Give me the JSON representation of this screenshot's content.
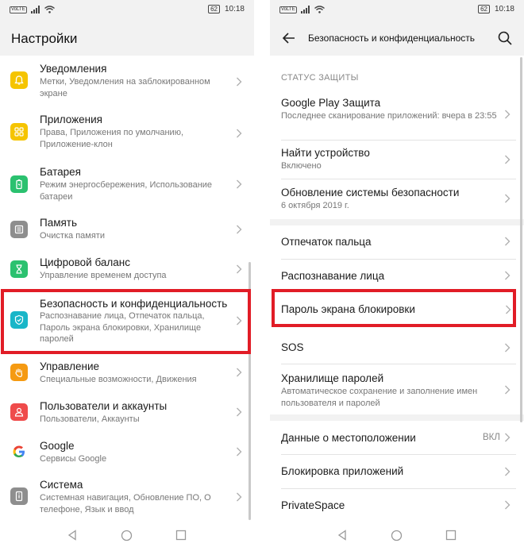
{
  "status_bar": {
    "sim": "VoLTE",
    "battery": "62",
    "time": "10:18"
  },
  "left": {
    "title": "Настройки",
    "items": [
      {
        "title": "Уведомления",
        "subtitle": "Метки, Уведомления на заблокированном экране",
        "icon": "bell-icon",
        "color": "#f5c400"
      },
      {
        "title": "Приложения",
        "subtitle": "Права, Приложения по умолчанию, Приложение-клон",
        "icon": "apps-grid-icon",
        "color": "#f5c400"
      },
      {
        "title": "Батарея",
        "subtitle": "Режим энергосбережения, Использование батареи",
        "icon": "battery-icon",
        "color": "#2bc16f"
      },
      {
        "title": "Память",
        "subtitle": "Очистка памяти",
        "icon": "storage-icon",
        "color": "#8e8e8e"
      },
      {
        "title": "Цифровой баланс",
        "subtitle": "Управление временем доступа",
        "icon": "hourglass-icon",
        "color": "#2bc16f"
      },
      {
        "title": "Безопасность и конфиденциальность",
        "subtitle": "Распознавание лица, Отпечаток пальца, Пароль экрана блокировки, Хранилище паролей",
        "icon": "shield-icon",
        "color": "#19b6c8"
      },
      {
        "title": "Управление",
        "subtitle": "Специальные возможности, Движения",
        "icon": "hand-icon",
        "color": "#f59a12"
      },
      {
        "title": "Пользователи и аккаунты",
        "subtitle": "Пользователи, Аккаунты",
        "icon": "user-icon",
        "color": "#ef4b4b"
      },
      {
        "title": "Google",
        "subtitle": "Сервисы Google",
        "icon": "google-icon",
        "color": "#ffffff"
      },
      {
        "title": "Система",
        "subtitle": "Системная навигация, Обновление ПО, О телефоне, Язык и ввод",
        "icon": "phone-info-icon",
        "color": "#8e8e8e"
      }
    ]
  },
  "right": {
    "title": "Безопасность и конфиденциальность",
    "section_label": "СТАТУС ЗАЩИТЫ",
    "items": [
      {
        "title": "Google Play Защита",
        "subtitle": "Последнее сканирование приложений: вчера в 23:55"
      },
      {
        "title": "Найти устройство",
        "subtitle": "Включено"
      },
      {
        "title": "Обновление системы безопасности",
        "subtitle": "6 октября 2019 г."
      },
      {
        "title": "Отпечаток пальца"
      },
      {
        "title": "Распознавание лица"
      },
      {
        "title": "Пароль экрана блокировки"
      },
      {
        "title": "SOS"
      },
      {
        "title": "Хранилище паролей",
        "subtitle": "Автоматическое сохранение и заполнение имен пользователя и паролей"
      },
      {
        "title": "Данные о местоположении",
        "value": "ВКЛ"
      },
      {
        "title": "Блокировка приложений"
      },
      {
        "title": "PrivateSpace"
      }
    ]
  },
  "highlight_color": "#e11c26"
}
